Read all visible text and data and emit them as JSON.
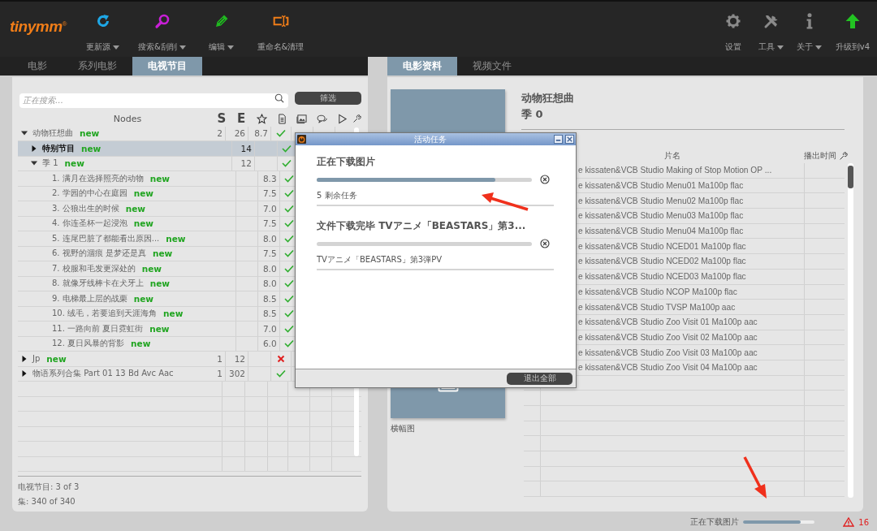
{
  "toolbar": {
    "logo": "tinymm",
    "logo_mark": "®",
    "left_tools": [
      {
        "kind": "refresh",
        "label": "更新源",
        "dropdown": true
      },
      {
        "kind": "search",
        "label": "搜索&刮削",
        "dropdown": true
      },
      {
        "kind": "edit",
        "label": "编辑",
        "dropdown": true
      },
      {
        "kind": "rename",
        "label": "重命名&清理",
        "dropdown": false
      }
    ],
    "right_tools": [
      {
        "kind": "settings",
        "label": "设置",
        "dropdown": false
      },
      {
        "kind": "tools",
        "label": "工具",
        "dropdown": true
      },
      {
        "kind": "about",
        "label": "关于",
        "dropdown": true
      },
      {
        "kind": "upgrade",
        "label": "升级到v4",
        "dropdown": false
      }
    ]
  },
  "left_tabs": [
    {
      "label": "电影",
      "selected": false
    },
    {
      "label": "系列电影",
      "selected": false
    },
    {
      "label": "电视节目",
      "selected": true
    }
  ],
  "right_tabs": [
    {
      "label": "电影资料",
      "selected": true
    },
    {
      "label": "视频文件",
      "selected": false
    }
  ],
  "tv_panel": {
    "search": {
      "placeholder": "正在搜索…"
    },
    "filter_button": "筛选",
    "columns": {
      "nodes": "Nodes",
      "s": "S",
      "e": "E"
    },
    "tree": [
      {
        "name": "动物狂想曲",
        "badge": "new",
        "s": "2",
        "e": "26",
        "rating": "8.7",
        "info_ok": true,
        "expanded": true,
        "selected": false,
        "children": [
          {
            "name": "特别节目",
            "badge": "new",
            "e": "14",
            "info_ok": true,
            "expanded": false,
            "selected": true
          },
          {
            "name": "季 1",
            "badge": "new",
            "e": "12",
            "info_ok": true,
            "expanded": true,
            "selected": false,
            "children": [
              {
                "name": "1. 满月在选择照亮的动物",
                "badge": "new",
                "rating": "8.3",
                "info_ok": true,
                "selected": false
              },
              {
                "name": "2. 学园的中心在庭园",
                "badge": "new",
                "rating": "7.5",
                "info_ok": true,
                "selected": false
              },
              {
                "name": "3. 公狼出生的时候",
                "badge": "new",
                "rating": "7.0",
                "info_ok": true,
                "selected": false
              },
              {
                "name": "4. 你连圣杯一起浸泡",
                "badge": "new",
                "rating": "7.5",
                "info_ok": true,
                "selected": false
              },
              {
                "name": "5. 连尾巴脏了都能看出原因...",
                "badge": "new",
                "rating": "8.0",
                "info_ok": true,
                "selected": false
              },
              {
                "name": "6. 视野的涸痕 是梦还是真",
                "badge": "new",
                "rating": "7.5",
                "info_ok": true,
                "selected": false
              },
              {
                "name": "7. 校服和毛发更深处的",
                "badge": "new",
                "rating": "8.0",
                "info_ok": true,
                "selected": false
              },
              {
                "name": "8. 就像牙线棒卡在犬牙上",
                "badge": "new",
                "rating": "8.0",
                "info_ok": true,
                "selected": false
              },
              {
                "name": "9. 电梯最上层的战栗",
                "badge": "new",
                "rating": "8.5",
                "info_ok": true,
                "selected": false
              },
              {
                "name": "10. 绒毛，若要追到天涯海角",
                "badge": "new",
                "rating": "8.5",
                "info_ok": true,
                "selected": false
              },
              {
                "name": "11. 一路向前 夏日霓虹街",
                "badge": "new",
                "rating": "7.0",
                "info_ok": true,
                "selected": false
              },
              {
                "name": "12. 夏日风暴的背影",
                "badge": "new",
                "rating": "6.0",
                "info_ok": true,
                "selected": false
              }
            ]
          }
        ]
      },
      {
        "name": "Jp",
        "badge": "new",
        "s": "1",
        "e": "12",
        "info_ok": false,
        "expanded": false,
        "selected": false
      },
      {
        "name": "物语系列合集 Part 01 13 Bd Avc Aac",
        "s": "1",
        "e": "302",
        "info_ok": true,
        "expanded": false,
        "selected": false
      }
    ],
    "footer": [
      "电视节目: 3 of 3",
      "集: 340 of 340"
    ]
  },
  "details": {
    "title": "动物狂想曲",
    "season": "季 0",
    "banner_label": "横幅图",
    "columns": [
      "片名",
      "播出时间"
    ],
    "episodes": [
      "e kissaten&VCB Studio Making of Stop Motion OP ...",
      "e kissaten&VCB Studio Menu01 Ma100p flac",
      "e kissaten&VCB Studio Menu02 Ma100p flac",
      "e kissaten&VCB Studio Menu03 Ma100p flac",
      "e kissaten&VCB Studio Menu04 Ma100p flac",
      "e kissaten&VCB Studio NCED01 Ma100p flac",
      "e kissaten&VCB Studio NCED02 Ma100p flac",
      "e kissaten&VCB Studio NCED03 Ma100p flac",
      "e kissaten&VCB Studio NCOP Ma100p flac",
      "e kissaten&VCB Studio TVSP Ma100p aac",
      "e kissaten&VCB Studio Zoo Visit 01 Ma100p aac",
      "e kissaten&VCB Studio Zoo Visit 02 Ma100p aac",
      "e kissaten&VCB Studio Zoo Visit 03 Ma100p aac",
      "e kissaten&VCB Studio Zoo Visit 04 Ma100p aac"
    ]
  },
  "dialog": {
    "title": "活动任务",
    "tasks": [
      {
        "title": "正在下载图片",
        "level": 0.83,
        "detail": "5 剩余任务"
      },
      {
        "title": "文件下载完毕 TVアニメ「BEASTARS」第3...",
        "level": 0,
        "detail": "TVアニメ「BEASTARS」第3弾PV"
      }
    ],
    "button": "退出全部"
  },
  "status_bar": {
    "text": "正在下载图片",
    "level": 0.8,
    "warnings": "16"
  }
}
